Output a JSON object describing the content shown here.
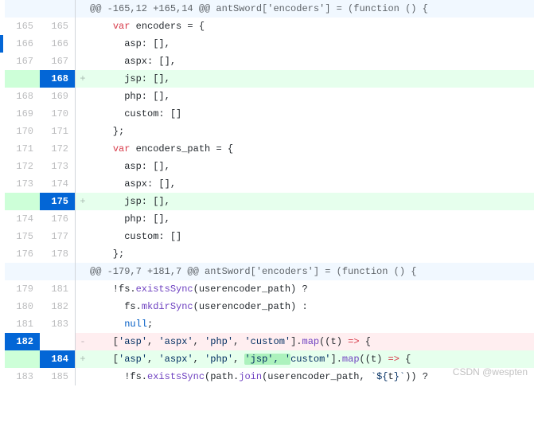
{
  "hunk1": "@@ -165,12 +165,14 @@ antSword['encoders'] = (function () {",
  "hunk2": "@@ -179,7 +181,7 @@ antSword['encoders'] = (function () {",
  "rows": [
    {
      "old": "165",
      "new": "165",
      "sign": "",
      "tokens": [
        {
          "t": "    "
        },
        {
          "t": "var ",
          "c": "var-kw"
        },
        {
          "t": "encoders = {"
        }
      ]
    },
    {
      "old": "166",
      "new": "166",
      "sign": "",
      "tokens": [
        {
          "t": "      asp: [],"
        }
      ]
    },
    {
      "old": "167",
      "new": "167",
      "sign": "",
      "tokens": [
        {
          "t": "      aspx: [],"
        }
      ]
    },
    {
      "old": "",
      "new": "168",
      "sign": "+",
      "add": true,
      "solidNew": true,
      "tokens": [
        {
          "t": "      jsp: [],"
        }
      ]
    },
    {
      "old": "168",
      "new": "169",
      "sign": "",
      "tokens": [
        {
          "t": "      php: [],"
        }
      ]
    },
    {
      "old": "169",
      "new": "170",
      "sign": "",
      "tokens": [
        {
          "t": "      custom: []"
        }
      ]
    },
    {
      "old": "170",
      "new": "171",
      "sign": "",
      "tokens": [
        {
          "t": "    };"
        }
      ]
    },
    {
      "old": "171",
      "new": "172",
      "sign": "",
      "tokens": [
        {
          "t": "    "
        },
        {
          "t": "var ",
          "c": "var-kw"
        },
        {
          "t": "encoders_path = {"
        }
      ]
    },
    {
      "old": "172",
      "new": "173",
      "sign": "",
      "tokens": [
        {
          "t": "      asp: [],"
        }
      ]
    },
    {
      "old": "173",
      "new": "174",
      "sign": "",
      "tokens": [
        {
          "t": "      aspx: [],"
        }
      ]
    },
    {
      "old": "",
      "new": "175",
      "sign": "+",
      "add": true,
      "solidNew": true,
      "tokens": [
        {
          "t": "      jsp: [],"
        }
      ]
    },
    {
      "old": "174",
      "new": "176",
      "sign": "",
      "tokens": [
        {
          "t": "      php: [],"
        }
      ]
    },
    {
      "old": "175",
      "new": "177",
      "sign": "",
      "tokens": [
        {
          "t": "      custom: []"
        }
      ]
    },
    {
      "old": "176",
      "new": "178",
      "sign": "",
      "tokens": [
        {
          "t": "    };"
        }
      ]
    }
  ],
  "rows2": [
    {
      "old": "179",
      "new": "181",
      "sign": "",
      "tokens": [
        {
          "t": "    !fs."
        },
        {
          "t": "existsSync",
          "c": "fn"
        },
        {
          "t": "(userencoder_path) ?"
        }
      ]
    },
    {
      "old": "180",
      "new": "182",
      "sign": "",
      "tokens": [
        {
          "t": "      fs."
        },
        {
          "t": "mkdirSync",
          "c": "fn"
        },
        {
          "t": "(userencoder_path) :"
        }
      ]
    },
    {
      "old": "181",
      "new": "183",
      "sign": "",
      "tokens": [
        {
          "t": "      "
        },
        {
          "t": "null",
          "c": "null"
        },
        {
          "t": ";"
        }
      ]
    },
    {
      "old": "182",
      "new": "",
      "sign": "-",
      "del": true,
      "solidOld": true,
      "tokens": [
        {
          "t": "    ["
        },
        {
          "t": "'asp'",
          "c": "str"
        },
        {
          "t": ", "
        },
        {
          "t": "'aspx'",
          "c": "str"
        },
        {
          "t": ", "
        },
        {
          "t": "'php'",
          "c": "str"
        },
        {
          "t": ", "
        },
        {
          "t": "'custom'",
          "c": "str"
        },
        {
          "t": "]."
        },
        {
          "t": "map",
          "c": "fn"
        },
        {
          "t": "(("
        },
        {
          "t": "t"
        },
        {
          "t": ") "
        },
        {
          "t": "=>",
          "c": "kw"
        },
        {
          "t": " {"
        }
      ]
    },
    {
      "old": "",
      "new": "184",
      "sign": "+",
      "add": true,
      "solidNew": true,
      "tokens": [
        {
          "t": "    ["
        },
        {
          "t": "'asp'",
          "c": "str"
        },
        {
          "t": ", "
        },
        {
          "t": "'aspx'",
          "c": "str"
        },
        {
          "t": ", "
        },
        {
          "t": "'php'",
          "c": "str"
        },
        {
          "t": ", "
        },
        {
          "t": "'jsp', '",
          "c": "str",
          "hl": true
        },
        {
          "t": "custom'",
          "c": "str"
        },
        {
          "t": "]."
        },
        {
          "t": "map",
          "c": "fn"
        },
        {
          "t": "(("
        },
        {
          "t": "t"
        },
        {
          "t": ") "
        },
        {
          "t": "=>",
          "c": "kw"
        },
        {
          "t": " {"
        }
      ]
    },
    {
      "old": "183",
      "new": "185",
      "sign": "",
      "tokens": [
        {
          "t": "      !fs."
        },
        {
          "t": "existsSync",
          "c": "fn"
        },
        {
          "t": "(path."
        },
        {
          "t": "join",
          "c": "fn"
        },
        {
          "t": "(userencoder_path, "
        },
        {
          "t": "`${",
          "c": "tpl"
        },
        {
          "t": "t"
        },
        {
          "t": "}`",
          "c": "tpl"
        },
        {
          "t": ")) ?"
        }
      ]
    }
  ],
  "watermark": "CSDN @wespten"
}
